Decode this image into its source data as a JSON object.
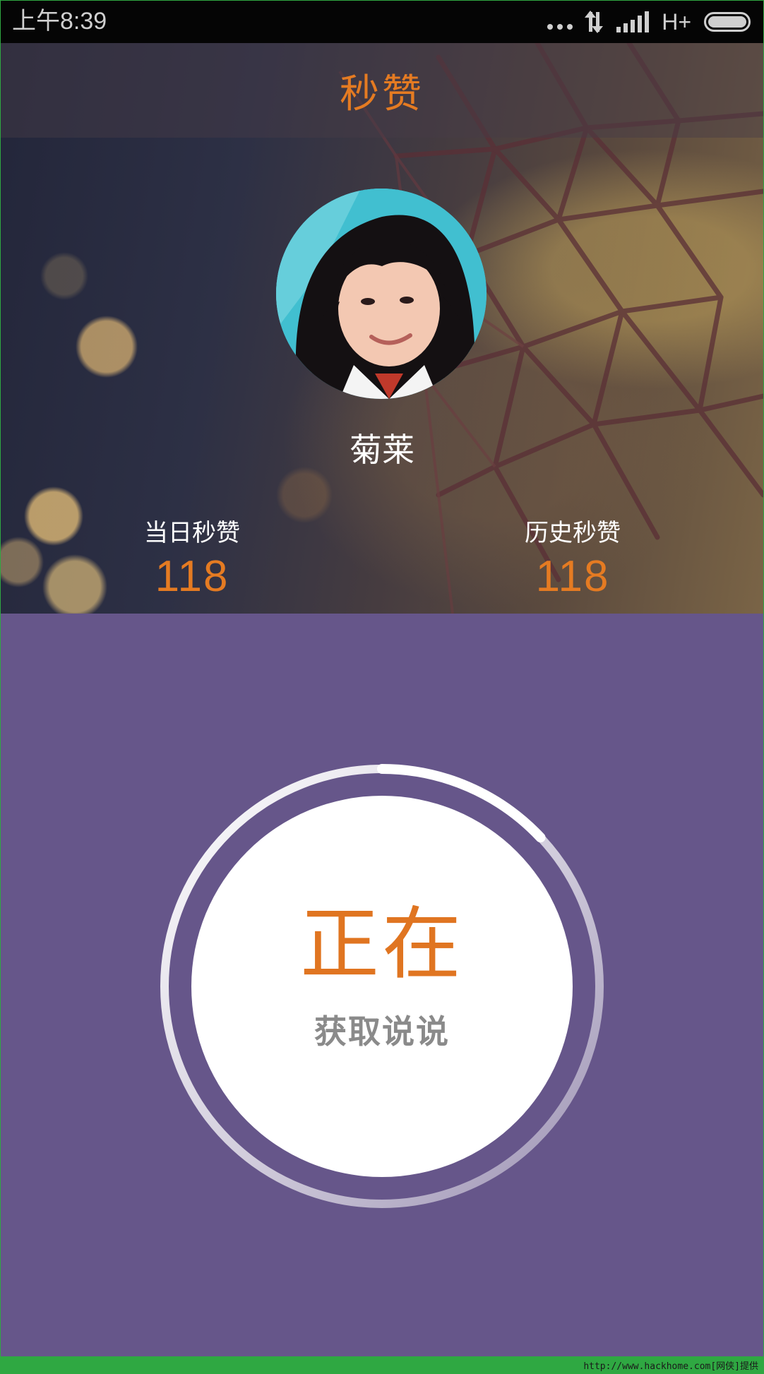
{
  "status_bar": {
    "time": "上午8:39",
    "network_type": "H+",
    "icons": [
      "more-dots-icon",
      "data-transfer-icon",
      "signal-icon",
      "battery-icon"
    ]
  },
  "header": {
    "title": "秒赞"
  },
  "profile": {
    "username": "菊莱"
  },
  "stats": {
    "today_label": "当日秒赞",
    "today_value": "118",
    "history_label": "历史秒赞",
    "history_value": "118"
  },
  "progress": {
    "status_main": "正在",
    "status_sub": "获取说说",
    "progress_fraction": 0.13
  },
  "footer": {
    "watermark": "http://www.hackhome.com[网侠]提供"
  },
  "colors": {
    "accent": "#e57b22",
    "background": "#66568a",
    "ring": "#ffffff",
    "footer_bar": "#2fa842"
  }
}
